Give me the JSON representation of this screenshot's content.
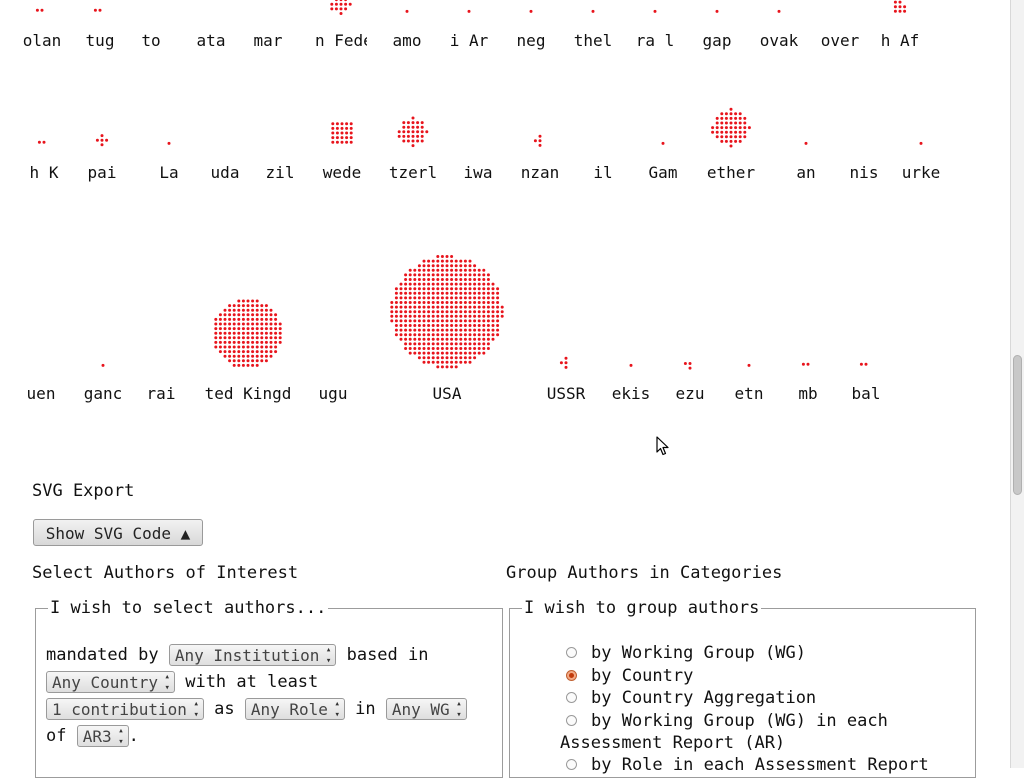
{
  "viz": {
    "row1": [
      {
        "label": "olan",
        "dots": 2
      },
      {
        "label": "tug",
        "dots": 2
      },
      {
        "label": "to",
        "dots": 0
      },
      {
        "label": "ata",
        "dots": 0
      },
      {
        "label": "mar",
        "dots": 0
      },
      {
        "label": "n Fede",
        "dots": 14
      },
      {
        "label": "amo",
        "dots": 1
      },
      {
        "label": "i Ar",
        "dots": 1
      },
      {
        "label": "neg",
        "dots": 1
      },
      {
        "label": "thel",
        "dots": 1
      },
      {
        "label": "ra l",
        "dots": 1
      },
      {
        "label": "gap",
        "dots": 1
      },
      {
        "label": "ovak",
        "dots": 1
      },
      {
        "label": "over",
        "dots": 0
      },
      {
        "label": "h Af",
        "dots": 8
      }
    ],
    "row2": [
      {
        "label": "h K",
        "dots": 2
      },
      {
        "label": "pai",
        "dots": 5
      },
      {
        "label": "La",
        "dots": 1
      },
      {
        "label": "uda",
        "dots": 0
      },
      {
        "label": "zil",
        "dots": 0
      },
      {
        "label": "wede",
        "dots": 25
      },
      {
        "label": "tzerl",
        "dots": 30
      },
      {
        "label": "iwa",
        "dots": 0
      },
      {
        "label": "nzan",
        "dots": 4
      },
      {
        "label": "il",
        "dots": 0
      },
      {
        "label": "Gam",
        "dots": 1
      },
      {
        "label": "ether",
        "dots": 50
      },
      {
        "label": "an",
        "dots": 1
      },
      {
        "label": "nis",
        "dots": 0
      },
      {
        "label": "urke",
        "dots": 1
      }
    ],
    "row3": [
      {
        "label": "uen",
        "dots": 0
      },
      {
        "label": "ganc",
        "dots": 1
      },
      {
        "label": "rai",
        "dots": 0
      },
      {
        "label": "ted Kingd",
        "dots": 180
      },
      {
        "label": "ugu",
        "dots": 0
      },
      {
        "label": "USA",
        "dots": 470
      },
      {
        "label": "USSR",
        "dots": 4
      },
      {
        "label": "ekis",
        "dots": 1
      },
      {
        "label": "ezu",
        "dots": 3
      },
      {
        "label": "etn",
        "dots": 1
      },
      {
        "label": "mb",
        "dots": 2
      },
      {
        "label": "bal",
        "dots": 2
      }
    ],
    "dot_color": "#e8141c"
  },
  "svg_export": {
    "title": "SVG Export",
    "button_label": "Show SVG Code ▲"
  },
  "select_section": {
    "title": "Select Authors of Interest",
    "legend": "I wish to select authors...",
    "text_mandated_by": "mandated by",
    "institution_value": "Any Institution",
    "text_based_in": "based in",
    "country_value": "Any Country",
    "text_with_at_least": "with at least",
    "contribution_value": "1 contribution",
    "text_as": "as",
    "role_value": "Any Role",
    "text_in": "in",
    "wg_value": "Any WG",
    "text_of": "of",
    "ar_value": "AR3",
    "text_period": "."
  },
  "group_section": {
    "title": "Group Authors in Categories",
    "legend": "I wish to group authors",
    "options": [
      "by Working Group (WG)",
      "by Country",
      "by Country Aggregation",
      "by Working Group (WG) in each",
      "by Role in each Assessment Report"
    ],
    "option_continuation": "Assessment Report (AR)",
    "selected_index": 1
  }
}
